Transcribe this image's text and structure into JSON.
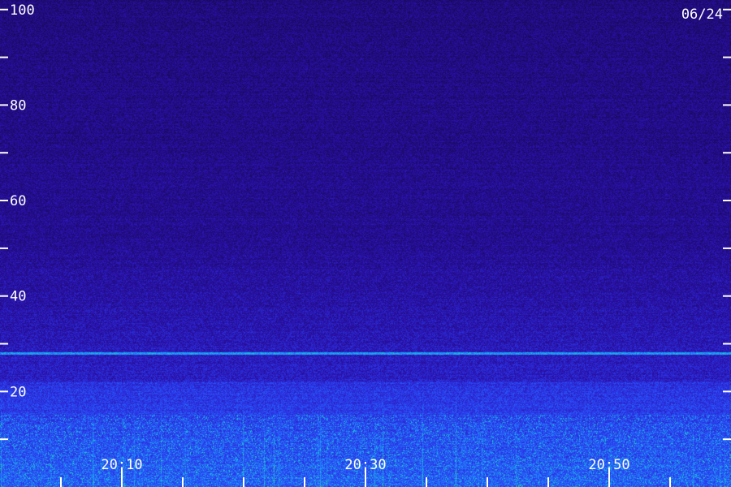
{
  "date_label": "06/24",
  "chart_data": {
    "type": "heatmap",
    "title": "",
    "xlabel": "",
    "ylabel": "",
    "y_ticks": [
      {
        "value": 100,
        "label": "100"
      },
      {
        "value": 80,
        "label": "80"
      },
      {
        "value": 60,
        "label": "60"
      },
      {
        "value": 40,
        "label": "40"
      },
      {
        "value": 20,
        "label": "20"
      }
    ],
    "y_minor": [
      90,
      70,
      50,
      30,
      10
    ],
    "ylim": [
      0,
      102
    ],
    "x_ticks": [
      {
        "value": 10,
        "label": "20:10"
      },
      {
        "value": 30,
        "label": "20:30"
      },
      {
        "value": 50,
        "label": "20:50"
      }
    ],
    "x_minor": [
      5,
      15,
      20,
      25,
      35,
      40,
      45,
      55
    ],
    "xlim": [
      0,
      60
    ],
    "grid": false,
    "colorscale": [
      "#1a0a5e",
      "#2a10a8",
      "#2c3cf0",
      "#1e8cff",
      "#18d2c8",
      "#3cf050"
    ]
  }
}
